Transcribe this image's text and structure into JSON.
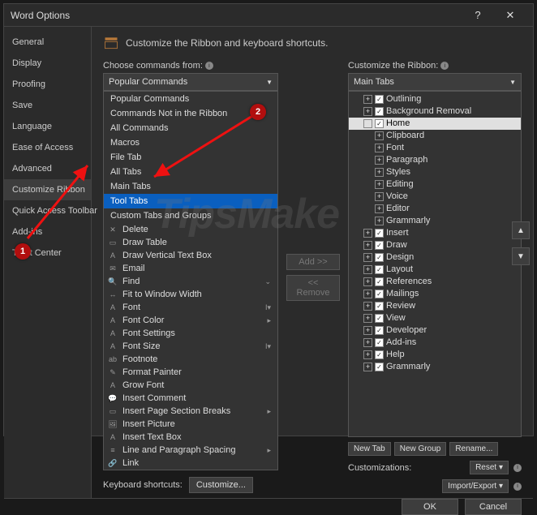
{
  "window": {
    "title": "Word Options"
  },
  "sidebar": {
    "items": [
      {
        "label": "General"
      },
      {
        "label": "Display"
      },
      {
        "label": "Proofing"
      },
      {
        "label": "Save"
      },
      {
        "label": "Language"
      },
      {
        "label": "Ease of Access"
      },
      {
        "label": "Advanced"
      },
      {
        "label": "Customize Ribbon",
        "selected": true
      },
      {
        "label": "Quick Access Toolbar"
      },
      {
        "label": "Add-ins"
      },
      {
        "label": "Trust Center"
      }
    ]
  },
  "header": {
    "text": "Customize the Ribbon and keyboard shortcuts."
  },
  "left": {
    "choose_label": "Choose commands from:",
    "combo_value": "Popular Commands",
    "dropdown": [
      "Popular Commands",
      "Commands Not in the Ribbon",
      "All Commands",
      "Macros",
      "File Tab",
      "All Tabs",
      "Main Tabs",
      "Tool Tabs",
      "Custom Tabs and Groups"
    ],
    "dropdown_highlight": "Tool Tabs",
    "commands": [
      {
        "icon": "✕",
        "label": "Delete"
      },
      {
        "icon": "▭",
        "label": "Draw Table"
      },
      {
        "icon": "A",
        "label": "Draw Vertical Text Box"
      },
      {
        "icon": "✉",
        "label": "Email"
      },
      {
        "icon": "🔍",
        "label": "Find",
        "sub": "⌄"
      },
      {
        "icon": "↔",
        "label": "Fit to Window Width"
      },
      {
        "icon": "A",
        "label": "Font",
        "sub": "I▾"
      },
      {
        "icon": "A",
        "label": "Font Color",
        "sub": "▸"
      },
      {
        "icon": "A",
        "label": "Font Settings"
      },
      {
        "icon": "A",
        "label": "Font Size",
        "sub": "I▾"
      },
      {
        "icon": "ab",
        "label": "Footnote"
      },
      {
        "icon": "✎",
        "label": "Format Painter"
      },
      {
        "icon": "A",
        "label": "Grow Font"
      },
      {
        "icon": "💬",
        "label": "Insert Comment"
      },
      {
        "icon": "▭",
        "label": "Insert Page  Section Breaks",
        "sub": "▸"
      },
      {
        "icon": "🖼",
        "label": "Insert Picture"
      },
      {
        "icon": "A",
        "label": "Insert Text Box"
      },
      {
        "icon": "≡",
        "label": "Line and Paragraph Spacing",
        "sub": "▸"
      },
      {
        "icon": "🔗",
        "label": "Link"
      }
    ],
    "kb_label": "Keyboard shortcuts:",
    "kb_button": "Customize..."
  },
  "mid": {
    "add_label": "Add >>",
    "remove_label": "<< Remove"
  },
  "right": {
    "customize_label": "Customize the Ribbon:",
    "combo_value": "Main Tabs",
    "tree": [
      {
        "depth": 1,
        "exp": "+",
        "chk": true,
        "label": "Outlining"
      },
      {
        "depth": 1,
        "exp": "+",
        "chk": true,
        "label": "Background Removal"
      },
      {
        "depth": 1,
        "exp": "−",
        "chk": true,
        "label": "Home",
        "selected": true
      },
      {
        "depth": 2,
        "exp": "+",
        "label": "Clipboard"
      },
      {
        "depth": 2,
        "exp": "+",
        "label": "Font"
      },
      {
        "depth": 2,
        "exp": "+",
        "label": "Paragraph"
      },
      {
        "depth": 2,
        "exp": "+",
        "label": "Styles"
      },
      {
        "depth": 2,
        "exp": "+",
        "label": "Editing"
      },
      {
        "depth": 2,
        "exp": "+",
        "label": "Voice"
      },
      {
        "depth": 2,
        "exp": "+",
        "label": "Editor"
      },
      {
        "depth": 2,
        "exp": "+",
        "label": "Grammarly"
      },
      {
        "depth": 1,
        "exp": "+",
        "chk": true,
        "label": "Insert"
      },
      {
        "depth": 1,
        "exp": "+",
        "chk": true,
        "label": "Draw"
      },
      {
        "depth": 1,
        "exp": "+",
        "chk": true,
        "label": "Design"
      },
      {
        "depth": 1,
        "exp": "+",
        "chk": true,
        "label": "Layout"
      },
      {
        "depth": 1,
        "exp": "+",
        "chk": true,
        "label": "References"
      },
      {
        "depth": 1,
        "exp": "+",
        "chk": true,
        "label": "Mailings"
      },
      {
        "depth": 1,
        "exp": "+",
        "chk": true,
        "label": "Review"
      },
      {
        "depth": 1,
        "exp": "+",
        "chk": true,
        "label": "View"
      },
      {
        "depth": 1,
        "exp": "+",
        "chk": true,
        "label": "Developer"
      },
      {
        "depth": 1,
        "exp": "+",
        "chk": true,
        "label": "Add-ins"
      },
      {
        "depth": 1,
        "exp": "+",
        "chk": true,
        "label": "Help"
      },
      {
        "depth": 1,
        "exp": "+",
        "chk": true,
        "label": "Grammarly"
      }
    ],
    "new_tab": "New Tab",
    "new_group": "New Group",
    "rename": "Rename...",
    "customizations_label": "Customizations:",
    "reset": "Reset ▾",
    "import_export": "Import/Export ▾"
  },
  "footer": {
    "ok": "OK",
    "cancel": "Cancel"
  },
  "annotations": {
    "badge1": "1",
    "badge2": "2"
  },
  "watermark": "TipsMake"
}
